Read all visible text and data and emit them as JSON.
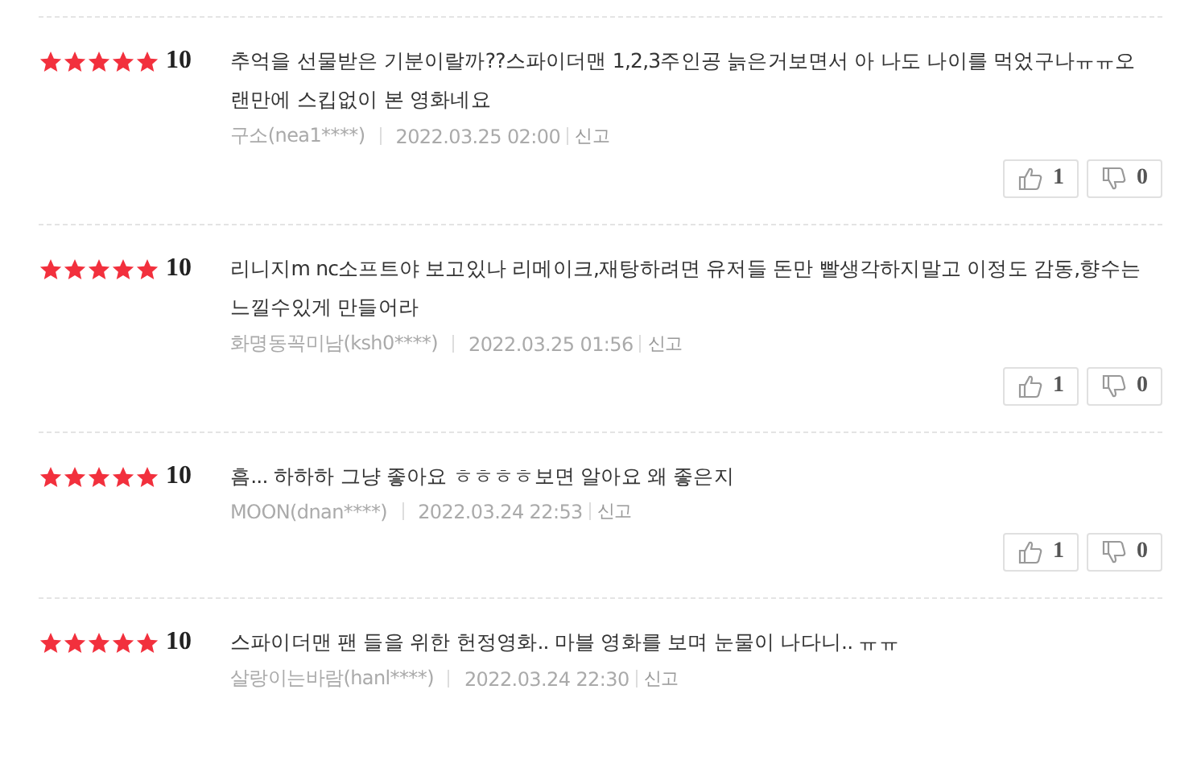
{
  "reviews": [
    {
      "stars": 5,
      "score": "10",
      "text": "추억을 선물받은 기분이랄까??스파이더맨 1,2,3주인공 늙은거보면서 아 나도 나이를 먹었구나ㅠㅠ오랜만에 스킵없이 본 영화네요",
      "author": "구소(nea1****)",
      "date": "2022.03.25 02:00",
      "report": "신고",
      "likes": "1",
      "dislikes": "0"
    },
    {
      "stars": 5,
      "score": "10",
      "text": "리니지m nc소프트야 보고있나 리메이크,재탕하려면 유저들 돈만 빨생각하지말고 이정도 감동,향수는 느낄수있게 만들어라",
      "author": "화명동꼭미남(ksh0****)",
      "date": "2022.03.25 01:56",
      "report": "신고",
      "likes": "1",
      "dislikes": "0"
    },
    {
      "stars": 5,
      "score": "10",
      "text": "흠... 하하하 그냥 좋아요 ㅎㅎㅎㅎ보면 알아요 왜 좋은지",
      "author": "MOON(dnan****)",
      "date": "2022.03.24 22:53",
      "report": "신고",
      "likes": "1",
      "dislikes": "0"
    },
    {
      "stars": 5,
      "score": "10",
      "text": "스파이더맨 팬 들을 위한 헌정영화.. 마블 영화를 보며 눈물이 나다니.. ㅠㅠ",
      "author": "살랑이는바람(hanl****)",
      "date": "2022.03.24 22:30",
      "report": "신고"
    }
  ]
}
